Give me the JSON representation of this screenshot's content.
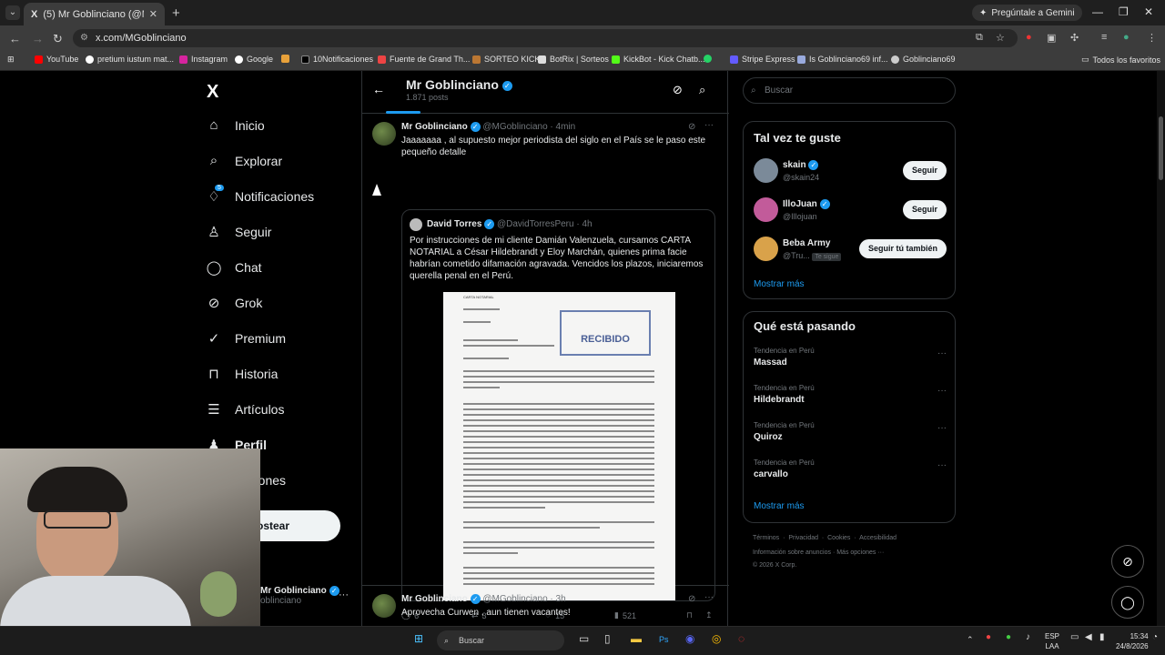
{
  "browser": {
    "tab_title": "(5) Mr Goblinciano (@MGoblin...",
    "tab_logo": "X",
    "new_tab": "+",
    "gemini_label": "Pregúntale a Gemini",
    "url": "x.com/MGoblinciano",
    "bookmarks": [
      "YouTube",
      "pretium iustum mat...",
      "Instagram",
      "Google",
      "",
      "10Notificaciones",
      "Fuente de Grand Th...",
      "SORTEO KICK",
      "BotRix | Sorteos",
      "KickBot - Kick Chatb...",
      "",
      "Stripe Express",
      "Is Goblinciano69 inf...",
      "Goblinciano69"
    ],
    "all_favorites": "Todos los favoritos"
  },
  "sidebar": {
    "logo": "X",
    "items": [
      {
        "label": "Inicio",
        "icon": "home-icon"
      },
      {
        "label": "Explorar",
        "icon": "search-icon"
      },
      {
        "label": "Notificaciones",
        "icon": "bell-icon",
        "badge": "5"
      },
      {
        "label": "Seguir",
        "icon": "add-person-icon"
      },
      {
        "label": "Chat",
        "icon": "chat-icon"
      },
      {
        "label": "Grok",
        "icon": "grok-icon"
      },
      {
        "label": "Premium",
        "icon": "premium-icon"
      },
      {
        "label": "Historia",
        "icon": "bookmark-icon"
      },
      {
        "label": "Artículos",
        "icon": "article-icon"
      },
      {
        "label": "Perfil",
        "icon": "person-icon"
      },
      {
        "label": "opciones",
        "icon": "more-icon"
      }
    ],
    "post_button": "ostear",
    "account_name": "Mr Goblinciano",
    "account_handle": "oblinciano"
  },
  "profile_header": {
    "name": "Mr Goblinciano",
    "posts": "1.871 posts"
  },
  "tweets": [
    {
      "name": "Mr Goblinciano",
      "handle": "@MGoblinciano",
      "time": "· 4min",
      "text": "Jaaaaaaa , al supuesto mejor periodista del siglo en el País se le paso este pequeño detalle",
      "quote": {
        "name": "David Torres",
        "handle": "@DavidTorresPeru",
        "time": "· 4h",
        "text": "Por instrucciones de mi cliente Damián Valenzuela, cursamos CARTA NOTARIAL a César Hildebrandt y Eloy Marchán, quienes prima facie habrían cometido difamación agravada. Vencidos los plazos, iniciaremos querella penal en el Perú.",
        "doc_header": "CARTA NOTARIAL",
        "doc_stamp": "RECIBIDO"
      },
      "replies": "6",
      "reposts": "3",
      "likes": "15",
      "views": "521"
    },
    {
      "name": "Mr Goblinciano",
      "handle": "@MGoblinciano",
      "time": "· 3h",
      "text": "Aprovecha Curwen , aun tienen vacantes!"
    }
  ],
  "right": {
    "search_placeholder": "Buscar",
    "who_to_follow_title": "Tal vez te guste",
    "suggestions": [
      {
        "name": "skain",
        "handle": "@skain24",
        "button": "Seguir",
        "color": "#7b8a99"
      },
      {
        "name": "IlloJuan",
        "handle": "@Illojuan",
        "button": "Seguir",
        "color": "#c25b9a"
      },
      {
        "name": "Beba Army",
        "handle": "@Tru...",
        "follows_you": "Te sigue",
        "button": "Seguir tú también",
        "color": "#d9a24a"
      }
    ],
    "show_more": "Mostrar más",
    "trending_title": "Qué está pasando",
    "trends": [
      {
        "context": "Tendencia en Perú",
        "name": "Massad"
      },
      {
        "context": "Tendencia en Perú",
        "name": "Hildebrandt"
      },
      {
        "context": "Tendencia en Perú",
        "name": "Quiroz"
      },
      {
        "context": "Tendencia en Perú",
        "name": "carvallo"
      }
    ],
    "show_more_2": "Mostrar más",
    "footer_links": [
      "Términos",
      "Privacidad",
      "Cookies",
      "Accesibilidad"
    ],
    "footer_line2": "Información sobre anuncios · Más opciones ···",
    "copyright": "© 2026 X Corp."
  },
  "taskbar": {
    "search": "Buscar",
    "lang": "ESP",
    "lang2": "LAA",
    "time": "15:34",
    "date": "24/8/2026"
  }
}
